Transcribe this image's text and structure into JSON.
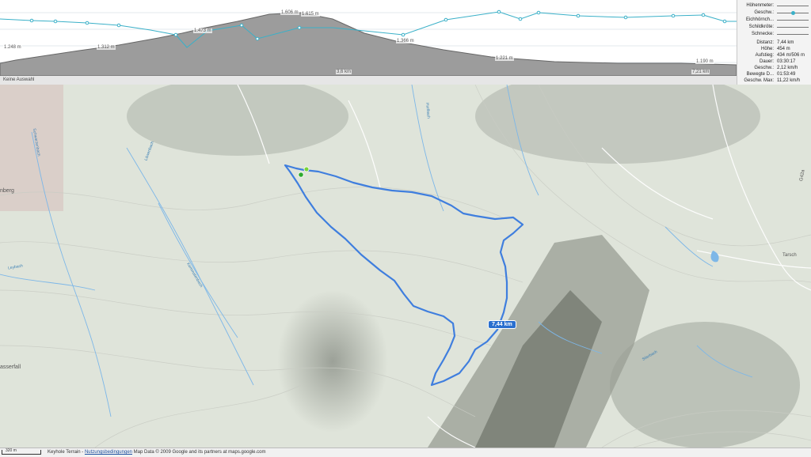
{
  "profile": {
    "elevation_labels": [
      "1.248 m",
      "1.312 m",
      "1.473 m",
      "1.606 m",
      "1.615 m",
      "1.366 m",
      "1.221 m",
      "1.190 m"
    ],
    "distance_labels": [
      "3,6 km",
      "7,21 km"
    ],
    "selection_text": "Keine Auswahl"
  },
  "legend": {
    "items": [
      {
        "label": "Höhenmeter:",
        "icon": "slider-line"
      },
      {
        "label": "Geschw.:",
        "icon": "slider-knob"
      },
      {
        "label": "Eichhörnch...",
        "icon": "slider-line"
      },
      {
        "label": "Schildkröte:",
        "icon": "slider-line"
      },
      {
        "label": "Schnecke:",
        "icon": "slider-line"
      }
    ]
  },
  "stats": {
    "rows": [
      {
        "label": "Distanz:",
        "value": "7,44 km"
      },
      {
        "label": "Höhe:",
        "value": "454 m"
      },
      {
        "label": "Aufstieg:",
        "value": "434 m/506 m"
      },
      {
        "label": "Dauer:",
        "value": "03:30:17"
      },
      {
        "label": "Geschw.:",
        "value": "2,12 km/h"
      },
      {
        "label": "Bewegte D...",
        "value": "01:53:49"
      },
      {
        "label": "Geschw. Max:",
        "value": "11,22 km/h"
      }
    ]
  },
  "map": {
    "route_badge": "7,44 km",
    "places": [
      "nberg",
      "asserfall"
    ],
    "streams": [
      "Löwenbach",
      "Schwarzenbach",
      "Leybach",
      "Kemmatenbach",
      "Hurlbach",
      "Stierbach"
    ],
    "roads": [
      "G42a",
      "Tarsch"
    ],
    "colors": {
      "route": "#3f7ede",
      "stream": "#7db7e8",
      "profile_line": "#3ab0c8",
      "badge": "#2a6fcf"
    }
  },
  "footer": {
    "scale_label": "320 m",
    "provider": "Keyhole Terrain",
    "terms_link": "Nutzungsbedingungen",
    "attribution": "Map Data © 2009 Google and its partners at maps.google.com"
  }
}
